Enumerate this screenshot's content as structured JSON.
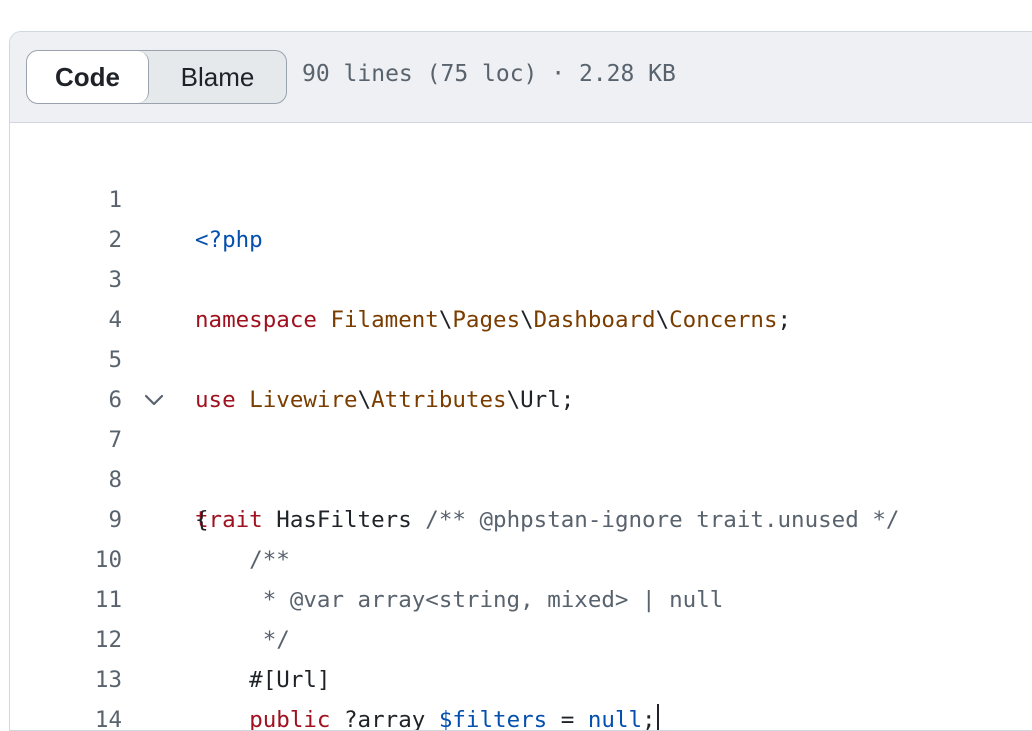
{
  "toolbar": {
    "code_label": "Code",
    "blame_label": "Blame",
    "file_info": "90 lines (75 loc) · 2.28 KB"
  },
  "code": {
    "line_numbers": [
      "1",
      "2",
      "3",
      "4",
      "5",
      "6",
      "7",
      "8",
      "9",
      "10",
      "11",
      "12",
      "13",
      "14"
    ],
    "l1": "<?php",
    "l3": {
      "kw": "namespace",
      "p1": "Filament",
      "s1": "\\",
      "p2": "Pages",
      "s2": "\\",
      "p3": "Dashboard",
      "s3": "\\",
      "p4": "Concerns",
      "end": ";"
    },
    "l5": {
      "kw": "use",
      "p1": "Livewire",
      "s1": "\\",
      "p2": "Attributes",
      "s2": "\\Url;"
    },
    "l7": {
      "kw": "trait",
      "name": " HasFilters ",
      "comment": "/** @phpstan-ignore trait.unused */"
    },
    "l8": "{",
    "l9": "    /**",
    "l10": "     * @var array<string, mixed> | null",
    "l11": "     */",
    "l12": "    #[Url]",
    "l13": {
      "indent": "    ",
      "kw": "public",
      "type": " ?array ",
      "var": "$filters",
      "eq": " = ",
      "val": "null",
      "end": ";"
    }
  }
}
